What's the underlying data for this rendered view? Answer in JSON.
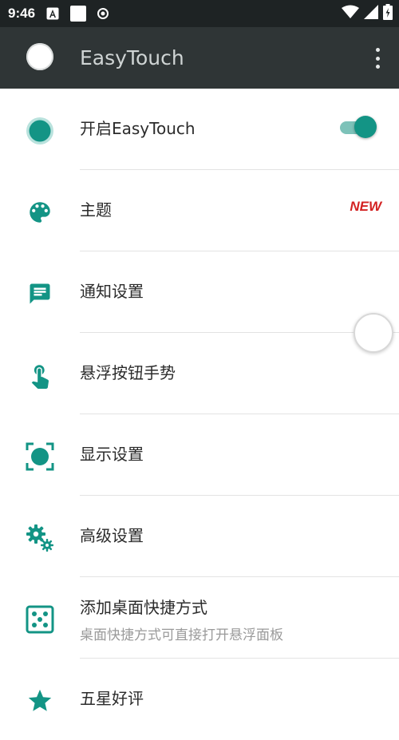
{
  "status_bar": {
    "time": "9:46",
    "icons": [
      "a-notification-icon",
      "square-notification-icon",
      "radio-notification-icon",
      "wifi-icon",
      "signal-icon",
      "battery-icon"
    ]
  },
  "app_bar": {
    "title": "EasyTouch",
    "menu_icon": "more-vert-icon",
    "background": "#2f3536"
  },
  "menu": [
    {
      "label": "开启EasyTouch",
      "icon": "toggle-dot-icon",
      "control": "switch",
      "switch_on": true
    },
    {
      "label": "主题",
      "icon": "palette-icon",
      "badge": "NEW"
    },
    {
      "label": "通知设置",
      "icon": "message-icon"
    },
    {
      "label": "悬浮按钮手势",
      "icon": "touch-icon"
    },
    {
      "label": "显示设置",
      "icon": "display-icon"
    },
    {
      "label": "高级设置",
      "icon": "gears-icon"
    },
    {
      "label": "添加桌面快捷方式",
      "subtitle": "桌面快捷方式可直接打开悬浮面板",
      "icon": "dice-icon"
    },
    {
      "label": "五星好评",
      "icon": "star-icon"
    }
  ],
  "colors": {
    "accent": "#139485",
    "badge": "#d32222"
  }
}
